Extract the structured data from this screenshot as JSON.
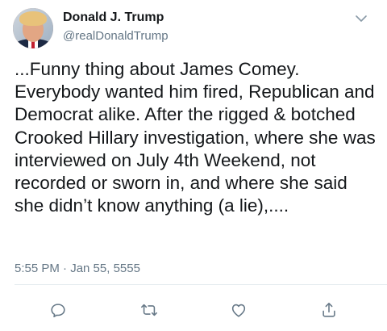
{
  "author": {
    "display_name": "Donald J. Trump",
    "handle": "@realDonaldTrump",
    "avatar_icon": "profile-photo"
  },
  "tweet": {
    "text": "...Funny thing about James Comey. Everybody wanted him fired, Republican and Democrat alike. After the rigged & botched Crooked Hillary investigation, where she was interviewed on July 4th Weekend, not recorded or sworn in, and where she said she didn’t know anything (a lie),....",
    "timestamp": "5:55 PM · Jan 55, 5555"
  },
  "actions": [
    {
      "name": "reply",
      "icon": "reply-icon"
    },
    {
      "name": "retweet",
      "icon": "retweet-icon"
    },
    {
      "name": "like",
      "icon": "heart-icon"
    },
    {
      "name": "share",
      "icon": "share-icon"
    }
  ],
  "colors": {
    "text": "#14171a",
    "secondary": "#657786",
    "icon": "#657786",
    "divider": "#e6ecf0"
  }
}
